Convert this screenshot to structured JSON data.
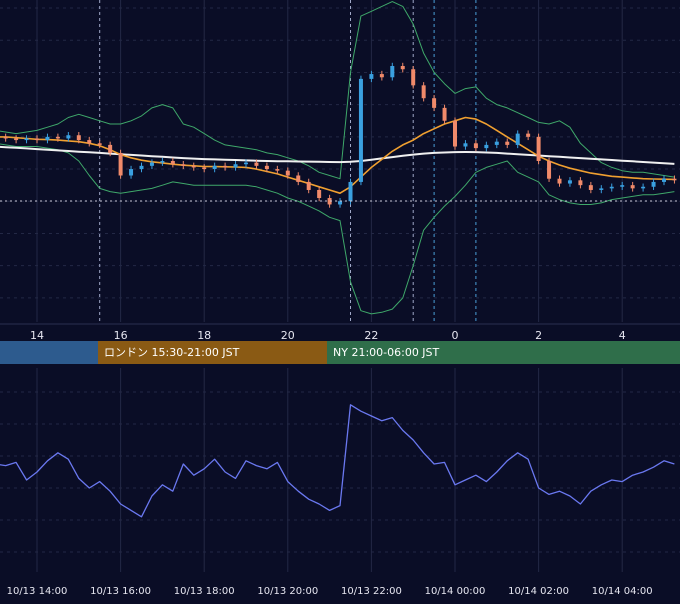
{
  "colors": {
    "background": "#0a0d26",
    "grid": "#232845",
    "candle_up": "#3aa0e0",
    "candle_down": "#f08a6a",
    "ma_short": "#f0a030",
    "ma_long": "#f0f0f0",
    "bollinger": "#3fa86a",
    "indicator_line": "#6a78f0",
    "session_tokyo": "#2d5b8e",
    "session_london": "#8a5a14",
    "session_ny": "#2f6e4a"
  },
  "sessions": [
    {
      "label": "",
      "color_key": "session_tokyo"
    },
    {
      "label": "ロンドン 15:30-21:00 JST",
      "color_key": "session_london"
    },
    {
      "label": "NY 21:00-06:00 JST",
      "color_key": "session_ny"
    }
  ],
  "chart_data": [
    {
      "type": "line",
      "title": "",
      "x_tick_labels": [
        "14",
        "16",
        "18",
        "20",
        "22",
        "0",
        "2",
        "4"
      ],
      "x_hours": [
        13.0,
        13.25,
        13.5,
        13.75,
        14.0,
        14.25,
        14.5,
        14.75,
        15.0,
        15.25,
        15.5,
        15.75,
        16.0,
        16.25,
        16.5,
        16.75,
        17.0,
        17.25,
        17.5,
        17.75,
        18.0,
        18.25,
        18.5,
        18.75,
        19.0,
        19.25,
        19.5,
        19.75,
        20.0,
        20.25,
        20.5,
        20.75,
        21.0,
        21.25,
        21.5,
        21.75,
        22.0,
        22.25,
        22.5,
        22.75,
        23.0,
        23.25,
        23.5,
        23.75,
        24.0,
        24.25,
        24.5,
        24.75,
        25.0,
        25.25,
        25.5,
        25.75,
        26.0,
        26.25,
        26.5,
        26.75,
        27.0,
        27.25,
        27.5,
        27.75,
        28.0,
        28.25,
        28.5,
        28.75,
        29.0,
        29.25
      ],
      "series": [
        {
          "role": "price_close",
          "color_key": "candle_up",
          "values": [
            60,
            59,
            58,
            59,
            58,
            60,
            59,
            61,
            58,
            56,
            55,
            50,
            36,
            40,
            42,
            44,
            45,
            43,
            42,
            41,
            40,
            42,
            41,
            43,
            44,
            42,
            40,
            39,
            36,
            32,
            27,
            22,
            18,
            20,
            32,
            96,
            99,
            97,
            104,
            102,
            92,
            84,
            78,
            70,
            54,
            56,
            53,
            55,
            57,
            55,
            62,
            60,
            45,
            34,
            31,
            33,
            30,
            27,
            28,
            29,
            30,
            28,
            29,
            32,
            34,
            33
          ]
        },
        {
          "role": "ma_short",
          "color_key": "ma_short",
          "values": [
            60,
            60,
            59.5,
            59,
            58.5,
            58.3,
            58,
            57.5,
            57,
            56,
            54.5,
            52,
            49,
            47,
            45.5,
            44.5,
            43.8,
            43,
            42.4,
            42,
            41.6,
            41.5,
            41.4,
            41.3,
            41,
            40,
            38.5,
            37,
            35,
            33,
            31,
            29,
            27,
            25,
            29,
            35,
            41,
            46,
            51,
            55,
            58,
            62,
            65,
            68,
            70,
            72,
            71,
            68,
            64,
            60,
            56,
            52,
            48,
            45,
            42.5,
            40.5,
            39,
            37.5,
            36.5,
            35.5,
            35,
            34.5,
            34,
            33.8,
            33.7,
            33.6
          ]
        },
        {
          "role": "ma_long",
          "color_key": "ma_long",
          "values": [
            54,
            53.6,
            53.2,
            52.8,
            52.4,
            52,
            51.6,
            51.2,
            50.8,
            50.4,
            50,
            49.6,
            49.2,
            48.8,
            48.4,
            48,
            47.6,
            47.2,
            46.8,
            46.5,
            46.2,
            46,
            45.8,
            45.6,
            45.4,
            45.2,
            45,
            44.9,
            44.8,
            44.7,
            44.6,
            44.5,
            44.4,
            44.3,
            44.5,
            45,
            45.8,
            46.6,
            47.4,
            48.2,
            49,
            49.6,
            50,
            50.3,
            50.5,
            50.6,
            50.5,
            50.3,
            50,
            49.6,
            49.2,
            48.8,
            48.4,
            48,
            47.6,
            47.2,
            46.8,
            46.4,
            46,
            45.6,
            45.2,
            44.8,
            44.4,
            44,
            43.6,
            43.2
          ]
        },
        {
          "role": "bollinger_upper",
          "color_key": "bollinger",
          "values": [
            64,
            63,
            62,
            63,
            64,
            66,
            68,
            72,
            74,
            72,
            70,
            68,
            68,
            70,
            73,
            78,
            80,
            78,
            68,
            66,
            62,
            58,
            55,
            54,
            53,
            52,
            50,
            49,
            47,
            45,
            42,
            38,
            36,
            34,
            100,
            135,
            138,
            141,
            144,
            141,
            130,
            112,
            100,
            93,
            87,
            90,
            91,
            84,
            80,
            78,
            75,
            72,
            69,
            68,
            70,
            66,
            56,
            50,
            44,
            41,
            39,
            38,
            38,
            37,
            36,
            35
          ]
        },
        {
          "role": "bollinger_lower",
          "color_key": "bollinger",
          "values": [
            56,
            55,
            54,
            54,
            54,
            53,
            52,
            50,
            45,
            36,
            28,
            26,
            25,
            26,
            27,
            28,
            30,
            32,
            31,
            30,
            30,
            30,
            30,
            30,
            30,
            29,
            27,
            25,
            22,
            20,
            17,
            14,
            10,
            8,
            -30,
            -48,
            -50,
            -49,
            -47,
            -40,
            -20,
            2,
            10,
            17,
            23,
            30,
            38,
            41,
            43,
            45,
            38,
            35,
            32,
            24,
            21,
            19,
            18,
            18,
            19,
            21,
            22,
            23,
            24,
            24,
            25,
            26
          ]
        }
      ]
    },
    {
      "type": "line",
      "title": "",
      "x_tick_labels": [
        "10/13 14:00",
        "10/13 16:00",
        "10/13 18:00",
        "10/13 20:00",
        "10/13 22:00",
        "10/14 00:00",
        "10/14 02:00",
        "10/14 04:00"
      ],
      "x_hours": [
        13.0,
        13.25,
        13.5,
        13.75,
        14.0,
        14.25,
        14.5,
        14.75,
        15.0,
        15.25,
        15.5,
        15.75,
        16.0,
        16.25,
        16.5,
        16.75,
        17.0,
        17.25,
        17.5,
        17.75,
        18.0,
        18.25,
        18.5,
        18.75,
        19.0,
        19.25,
        19.5,
        19.75,
        20.0,
        20.25,
        20.5,
        20.75,
        21.0,
        21.25,
        21.5,
        21.75,
        22.0,
        22.25,
        22.5,
        22.75,
        23.0,
        23.25,
        23.5,
        23.75,
        24.0,
        24.25,
        24.5,
        24.75,
        25.0,
        25.25,
        25.5,
        25.75,
        26.0,
        26.25,
        26.5,
        26.75,
        27.0,
        27.25,
        27.5,
        27.75,
        28.0,
        28.25,
        28.5,
        28.75,
        29.0,
        29.25
      ],
      "series": [
        {
          "role": "oscillator",
          "color_key": "indicator_line",
          "values": [
            55,
            54,
            56,
            45,
            50,
            57,
            62,
            58,
            46,
            40,
            44,
            38,
            30,
            26,
            22,
            35,
            42,
            38,
            55,
            48,
            52,
            58,
            50,
            46,
            57,
            54,
            52,
            56,
            44,
            38,
            33,
            30,
            26,
            29,
            92,
            88,
            85,
            82,
            84,
            76,
            70,
            62,
            55,
            56,
            42,
            45,
            48,
            44,
            50,
            57,
            62,
            58,
            40,
            36,
            38,
            35,
            30,
            38,
            42,
            45,
            44,
            48,
            50,
            53,
            57,
            55
          ]
        }
      ]
    }
  ]
}
